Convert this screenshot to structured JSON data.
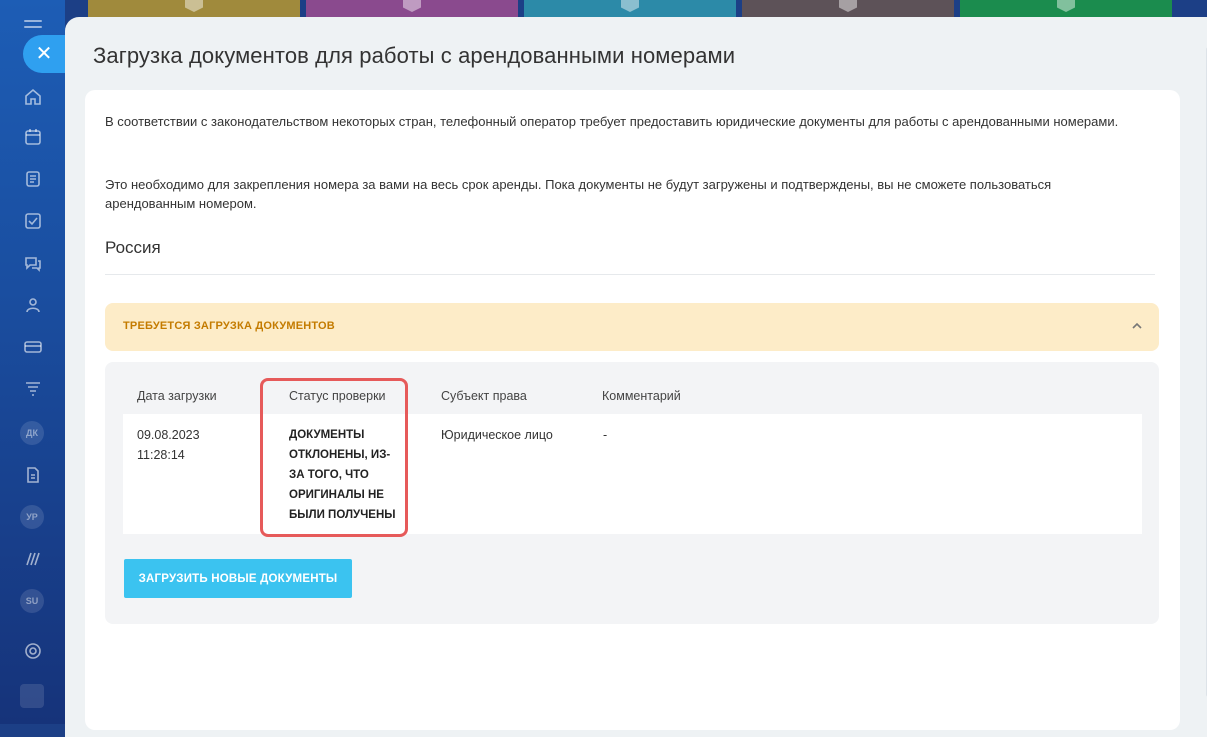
{
  "page": {
    "title": "Загрузка документов для работы с арендованными номерами"
  },
  "sidebar": {
    "close_label": "✕",
    "badges": [
      "ДК",
      "УР",
      "SU"
    ]
  },
  "content": {
    "paragraph1": "В соответствии с законодательством некоторых стран, телефонный оператор требует предоставить юридические документы для работы с арендованными номерами.",
    "paragraph2": "Это необходимо для закрепления номера за вами на весь срок аренды. Пока документы не будут загружены и подтверждены, вы не сможете пользоваться арендованным номером.",
    "country": "Россия"
  },
  "alert": {
    "text": "ТРЕБУЕТСЯ ЗАГРУЗКА ДОКУМЕНТОВ"
  },
  "table": {
    "headers": [
      "Дата загрузки",
      "Статус проверки",
      "Субъект права",
      "Комментарий"
    ],
    "rows": [
      {
        "date": "09.08.2023",
        "time": "11:28:14",
        "status": "ДОКУМЕНТЫ ОТКЛОНЕНЫ, ИЗ-ЗА ТОГО, ЧТО ОРИГИНАЛЫ НЕ БЫЛИ ПОЛУЧЕНЫ",
        "subject": "Юридическое лицо",
        "comment": "-"
      }
    ]
  },
  "actions": {
    "upload_label": "ЗАГРУЗИТЬ НОВЫЕ ДОКУМЕНТЫ"
  },
  "colors": {
    "accent": "#3bc3f0",
    "warning_bg": "#fdecc8",
    "warning_text": "#c47b00",
    "highlight_border": "#e65a5a"
  }
}
